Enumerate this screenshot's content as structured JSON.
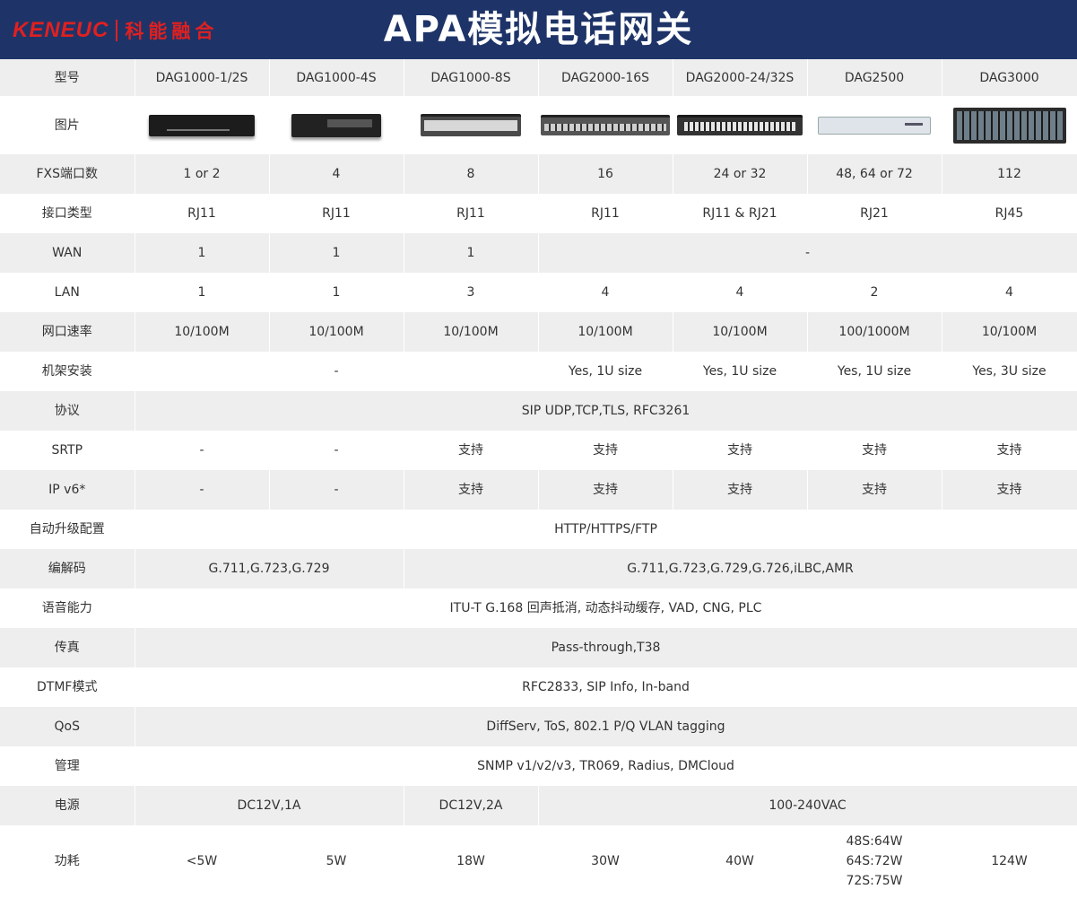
{
  "header": {
    "logo_latin": "KENEUC",
    "logo_cn": "科能融合",
    "title": "APA模拟电话网关",
    "bg_color": "#1e3468",
    "logo_color": "#e02020"
  },
  "table": {
    "model_label": "型号",
    "models": [
      "DAG1000-1/2S",
      "DAG1000-4S",
      "DAG1000-8S",
      "DAG2000-16S",
      "DAG2000-24/32S",
      "DAG2500",
      "DAG3000"
    ],
    "image_label": "图片",
    "fxs_label": "FXS端口数",
    "fxs": [
      "1 or 2",
      "4",
      "8",
      "16",
      "24 or 32",
      "48, 64 or 72",
      "112"
    ],
    "iface_label": "接口类型",
    "iface": [
      "RJ11",
      "RJ11",
      "RJ11",
      "RJ11",
      "RJ11 & RJ21",
      "RJ21",
      "RJ45"
    ],
    "wan_label": "WAN",
    "wan": [
      "1",
      "1",
      "1",
      "-"
    ],
    "lan_label": "LAN",
    "lan": [
      "1",
      "1",
      "3",
      "4",
      "4",
      "2",
      "4"
    ],
    "speed_label": "网口速率",
    "speed": [
      "10/100M",
      "10/100M",
      "10/100M",
      "10/100M",
      "10/100M",
      "100/1000M",
      "10/100M"
    ],
    "rack_label": "机架安装",
    "rack": [
      "-",
      "Yes, 1U size",
      "Yes, 1U size",
      "Yes, 1U size",
      "Yes, 3U size"
    ],
    "proto_label": "协议",
    "proto": "SIP UDP,TCP,TLS, RFC3261",
    "srtp_label": "SRTP",
    "srtp": [
      "-",
      "-",
      "支持",
      "支持",
      "支持",
      "支持",
      "支持"
    ],
    "ipv6_label": "IP v6*",
    "ipv6": [
      "-",
      "-",
      "支持",
      "支持",
      "支持",
      "支持",
      "支持"
    ],
    "autoprov_label": "自动升级配置",
    "autoprov": "HTTP/HTTPS/FTP",
    "codec_label": "编解码",
    "codec": [
      "G.711,G.723,G.729",
      "G.711,G.723,G.729,G.726,iLBC,AMR"
    ],
    "voice_label": "语音能力",
    "voice": "ITU-T G.168 回声抵消, 动态抖动缓存, VAD, CNG, PLC",
    "fax_label": "传真",
    "fax": "Pass-through,T38",
    "dtmf_label": "DTMF模式",
    "dtmf": "RFC2833, SIP Info, In-band",
    "qos_label": "QoS",
    "qos": "DiffServ, ToS, 802.1 P/Q VLAN tagging",
    "mgmt_label": "管理",
    "mgmt": "SNMP v1/v2/v3, TR069, Radius, DMCloud",
    "power_label": "电源",
    "power": [
      "DC12V,1A",
      "DC12V,2A",
      "100-240VAC"
    ],
    "consumption_label": "功耗",
    "consumption": [
      "<5W",
      "5W",
      "18W",
      "30W",
      "40W",
      "",
      "124W"
    ],
    "consumption_dag2500": [
      "48S:64W",
      "64S:72W",
      "72S:75W"
    ]
  }
}
